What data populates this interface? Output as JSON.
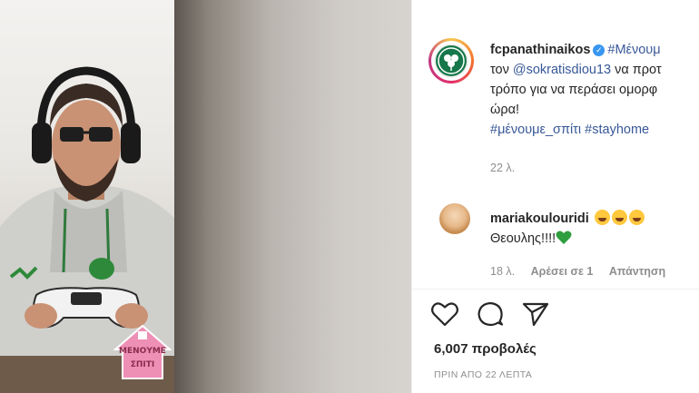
{
  "post": {
    "username": "fcpanathinaikos",
    "caption_line1": "#Μένουμ",
    "caption_line2_prefix": "τον ",
    "caption_mention": "@sokratisdiou13",
    "caption_line2_suffix": " να προτ",
    "caption_line3": "τρόπο για να περάσει ομορφ",
    "caption_line4": "ώρα!",
    "caption_hashtags": "#μένουμε_σπίτι #stayhome",
    "time": "22 λ."
  },
  "comment": {
    "username": "mariakoulouridi",
    "text": "Θεουλης!!!!",
    "time": "18 λ.",
    "likes": "Αρέσει σε 1",
    "reply": "Απάντηση"
  },
  "stats": {
    "views": "6,007 προβολές",
    "posted": "ΠΡΙΝ ΑΠΟ 22 ΛΕΠΤΑ"
  },
  "sticker": {
    "line1": "ΜΕΝΟΥΜΕ",
    "line2": "ΣΠΙΤΙ"
  },
  "icons": {
    "verified": "verified-badge-icon",
    "like": "heart-icon",
    "comment": "comment-icon",
    "share": "send-icon"
  },
  "colors": {
    "link": "#385898",
    "verified": "#3897f0",
    "meta": "#8e8e8e",
    "green_heart": "#2e9e3e"
  }
}
